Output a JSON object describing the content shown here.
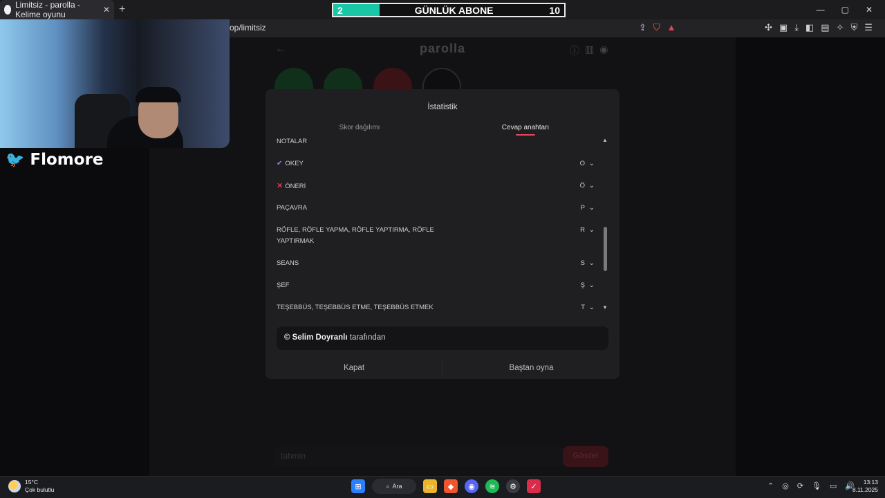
{
  "browser": {
    "tab_title": "Limitsiz - parolla - Kelime oyunu",
    "tab_close": "✕",
    "new_tab": "+",
    "url": "op/limitsiz",
    "window_controls": [
      "—",
      "▢",
      "✕"
    ]
  },
  "overlay": {
    "current": "2",
    "title": "GÜNLÜK ABONE",
    "goal": "10",
    "progress_fraction": 0.2
  },
  "streamer": {
    "handle": "Flomore"
  },
  "game": {
    "title": "parolla",
    "input_placeholder": "tahmin",
    "submit_label": "Gönder"
  },
  "modal": {
    "title": "İstatistik",
    "tabs": {
      "score": "Skor dağılımı",
      "answers": "Cevap anahtarı"
    },
    "rows": [
      {
        "word": "NOTALAR",
        "letter": "",
        "mark": ""
      },
      {
        "word": "OKEY",
        "letter": "O",
        "mark": "ok"
      },
      {
        "word": "ÖNERİ",
        "letter": "Ö",
        "mark": "bad"
      },
      {
        "word": "PAÇAVRA",
        "letter": "P",
        "mark": ""
      },
      {
        "word": "RÖFLE, RÖFLE YAPMA, RÖFLE YAPTIRMA, RÖFLE YAPTIRMAK",
        "letter": "R",
        "mark": ""
      },
      {
        "word": "SEANS",
        "letter": "S",
        "mark": ""
      },
      {
        "word": "ŞEF",
        "letter": "Ş",
        "mark": ""
      },
      {
        "word": "TEŞEBBÜS, TEŞEBBÜS ETME, TEŞEBBÜS ETMEK",
        "letter": "T",
        "mark": ""
      }
    ],
    "credit_name": "© Selim Doyranlı",
    "credit_suffix": " tarafından",
    "close_label": "Kapat",
    "restart_label": "Baştan oyna"
  },
  "taskbar": {
    "temp": "15°C",
    "weather": "Çok bulutlu",
    "search_label": "Ara",
    "time": "13:13",
    "date": "8.11.2025"
  },
  "colors": {
    "accent": "#e8455c",
    "counter_fill": "#19c6a6",
    "check": "#9a7cff",
    "cross": "#ff4d6d"
  }
}
